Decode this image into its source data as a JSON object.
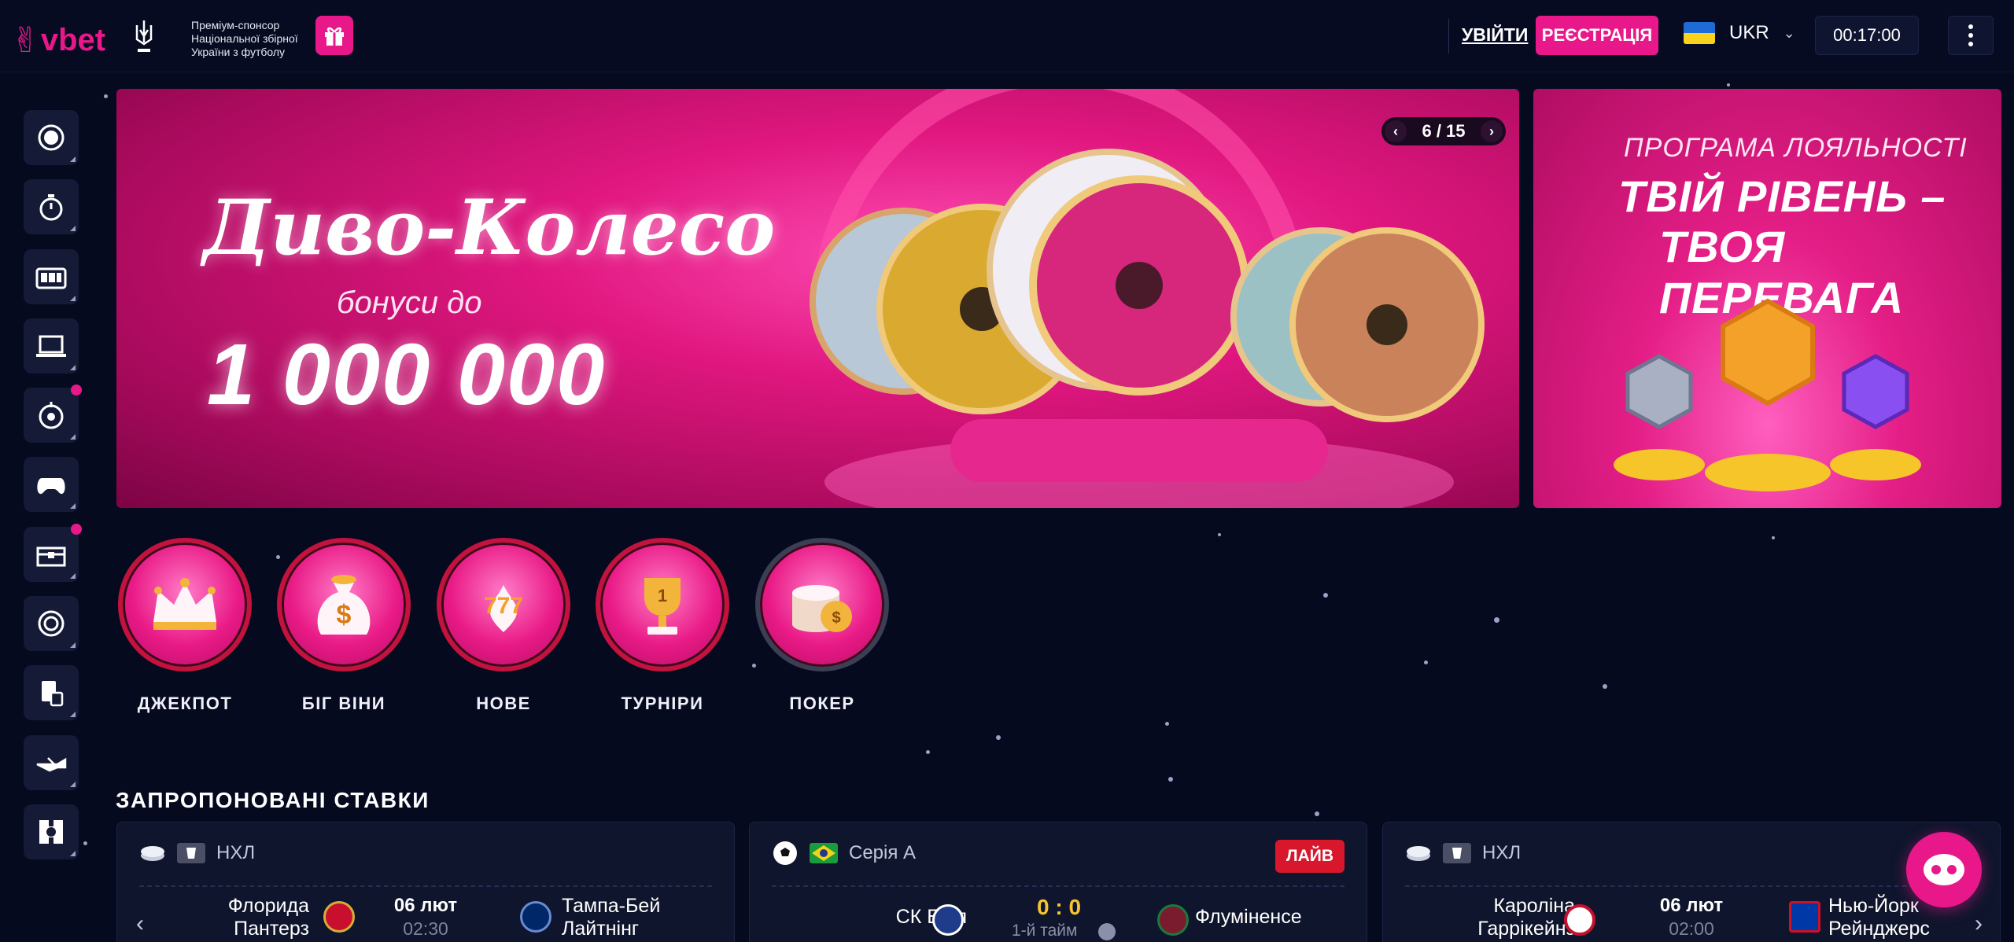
{
  "header": {
    "brand": "vbet",
    "sponsor_text": "Преміум-спонсор Національної збірної України з футболу",
    "login_label": "УВІЙТИ",
    "register_label": "РЕЄСТРАЦІЯ",
    "language": "UKR",
    "clock": "00:17:00"
  },
  "banner": {
    "title": "Диво-Колесо",
    "subtitle": "бонуси до",
    "amount": "1 000 000",
    "pager": "6 / 15"
  },
  "side_banner": {
    "line1": "ПРОГРАМА ЛОЯЛЬНОСТІ",
    "line2": "ТВІЙ РІВЕНЬ –",
    "line3": "ТВОЯ ПЕРЕВАГА"
  },
  "categories": [
    {
      "label": "ДЖЕКПОТ",
      "icon": "crown-icon"
    },
    {
      "label": "БІГ ВІНИ",
      "icon": "money-bag-icon"
    },
    {
      "label": "НОВЕ",
      "icon": "slot-777-icon"
    },
    {
      "label": "ТУРНІРИ",
      "icon": "trophy-icon"
    },
    {
      "label": "ПОКЕР",
      "icon": "poker-chips-icon"
    }
  ],
  "section_title": "ЗАПРОПОНОВАНІ СТАВКИ",
  "bets": [
    {
      "league": "НХЛ",
      "team_left_1": "Флорида",
      "team_left_2": "Пантерз",
      "date": "06 лют",
      "time": "02:30",
      "team_right_1": "Тампа-Бей",
      "team_right_2": "Лайтнінг"
    },
    {
      "league": "Серія А",
      "live": "ЛАЙВ",
      "team_left": "СК Баїя",
      "score": "0 : 0",
      "period": "1-й тайм",
      "team_right": "Флуміненсе"
    },
    {
      "league": "НХЛ",
      "team_left_1": "Кароліна",
      "team_left_2": "Гаррікейнз",
      "date": "06 лют",
      "time": "02:00",
      "team_right_1": "Нью-Йорк",
      "team_right_2": "Рейнджерс"
    }
  ],
  "colors": {
    "accent": "#e9188a",
    "background": "#050a1f",
    "live": "#d8172c",
    "score": "#f5c430"
  }
}
